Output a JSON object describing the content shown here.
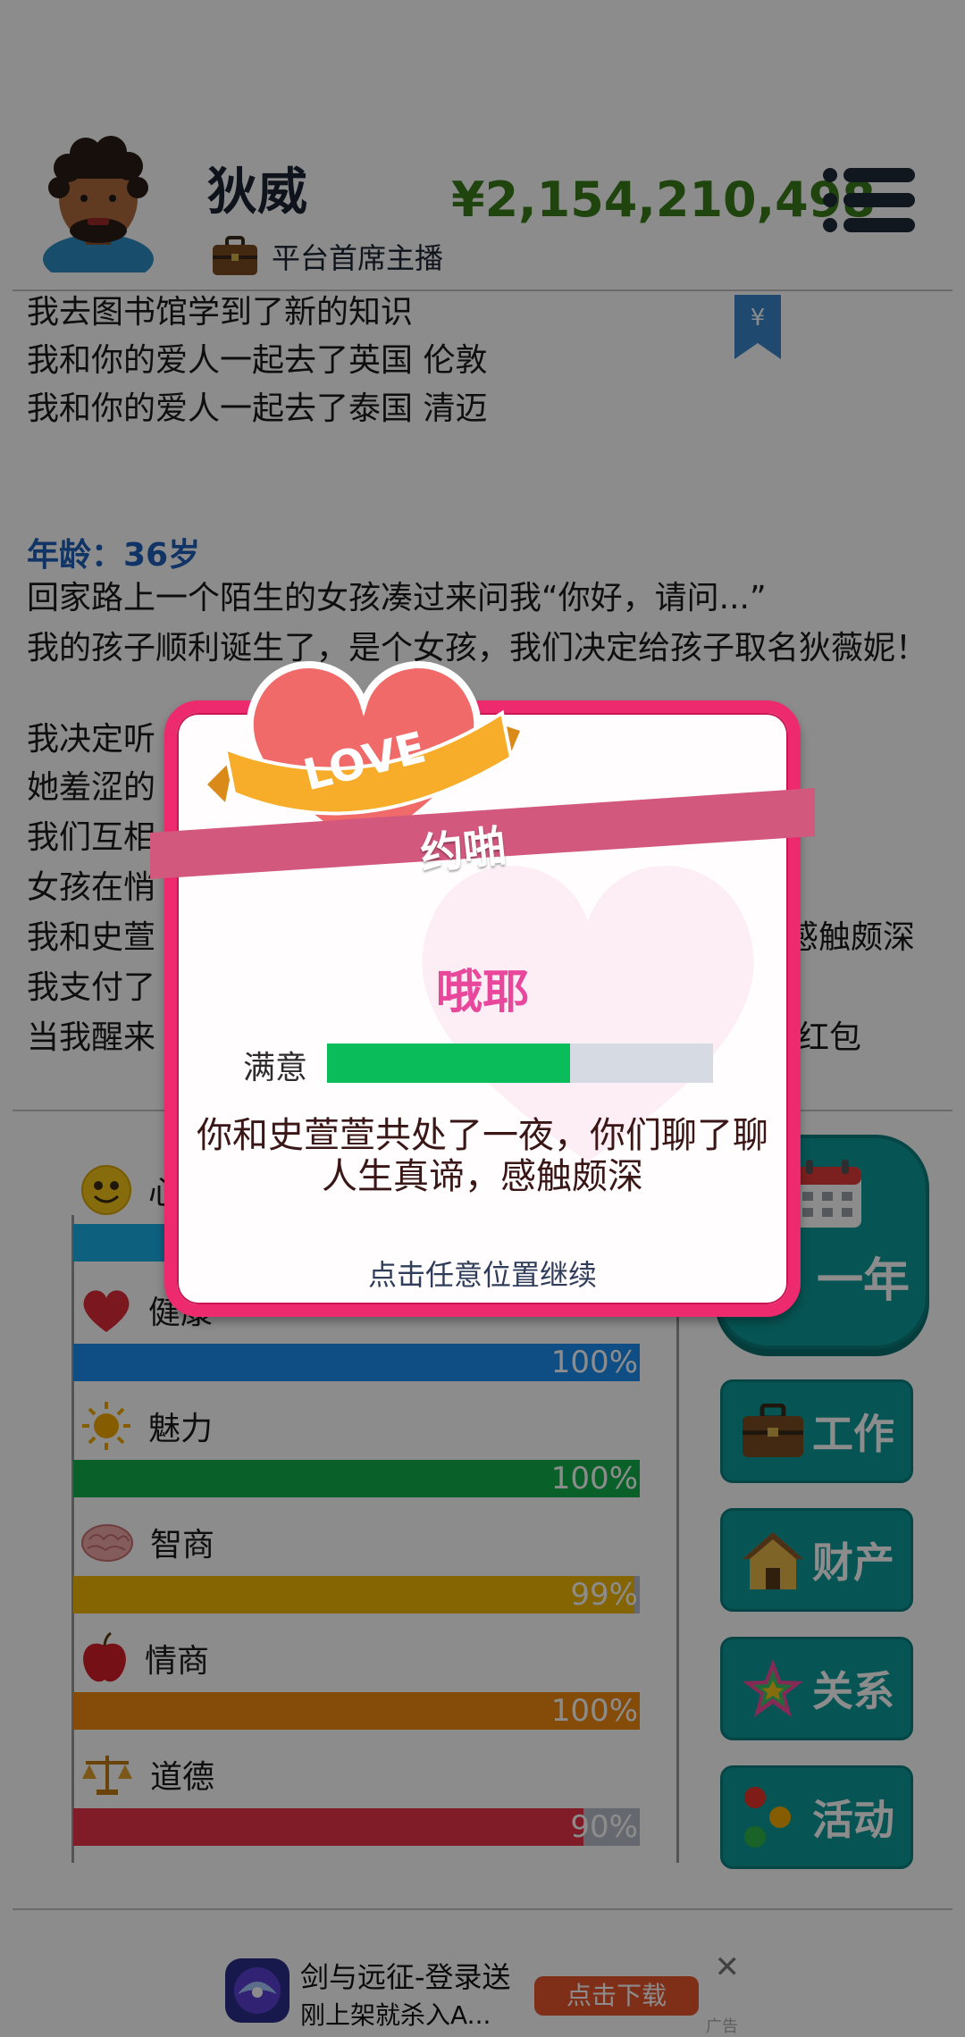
{
  "header": {
    "name": "狄威",
    "job": "平台首席主播",
    "money": "¥2,154,210,498"
  },
  "log": {
    "lines_top": [
      "我去图书馆学到了新的知识",
      "我和你的爱人一起去了英国 伦敦",
      "我和你的爱人一起去了泰国 清迈"
    ],
    "age": "年龄：36岁",
    "lines_age": [
      "回家路上一个陌生的女孩凑过来问我“你好，请问...”",
      "我的孩子顺利诞生了，是个女孩，我们决定给孩子取名狄薇妮！",
      "我决定听",
      "她羞涩的",
      "我们互相",
      "女孩在悄",
      "我和史萱",
      "我支付了",
      "当我醒来"
    ],
    "right_fragments": [
      "感触颇深",
      "红包"
    ],
    "bookmark_symbol": "¥"
  },
  "stats": [
    {
      "name": "心情",
      "percent": 100,
      "color": "#1bb0e8",
      "icon": "smiley-icon"
    },
    {
      "name": "健康",
      "percent": 100,
      "color": "#1d8ef0",
      "icon": "heart-icon"
    },
    {
      "name": "魅力",
      "percent": 100,
      "color": "#11b04a",
      "icon": "sun-icon"
    },
    {
      "name": "智商",
      "percent": 99,
      "color": "#f2b705",
      "icon": "brain-icon"
    },
    {
      "name": "情商",
      "percent": 100,
      "color": "#f08a10",
      "icon": "apple-icon"
    },
    {
      "name": "道德",
      "percent": 90,
      "color": "#e8334a",
      "icon": "scales-icon"
    }
  ],
  "stat_labels": {
    "s0": "心",
    "s1": "健康",
    "s2": "魅力",
    "s3": "智商",
    "s4": "情商",
    "s5": "道德",
    "p1": "100%",
    "p2": "100%",
    "p3": "99%",
    "p4": "100%",
    "p5": "90%"
  },
  "side_buttons": {
    "next_year": "一年",
    "work": "工作",
    "assets": "财产",
    "relations": "关系",
    "activities": "活动"
  },
  "ad": {
    "title": "剑与远征-登录送",
    "subtitle": "刚上架就杀入A...",
    "download": "点击下载",
    "close": "✕",
    "tag": "广告"
  },
  "modal": {
    "badge_text": "LOVE",
    "ribbon_title": "约啪",
    "title": "哦耶",
    "satisfaction_label": "满意",
    "satisfaction": 0.63,
    "message": "你和史萱萱共处了一夜，你们聊了聊人生真谛，感触颇深",
    "hint": "点击任意位置继续"
  },
  "colors": {
    "money": "#3b7d1a",
    "age": "#1e5fb8",
    "button_teal": "#0d9a9a",
    "modal_border": "#ee2a6e",
    "ribbon": "#d2587e",
    "modal_title": "#e8479c",
    "satisfaction_fill": "#0abd5a"
  }
}
